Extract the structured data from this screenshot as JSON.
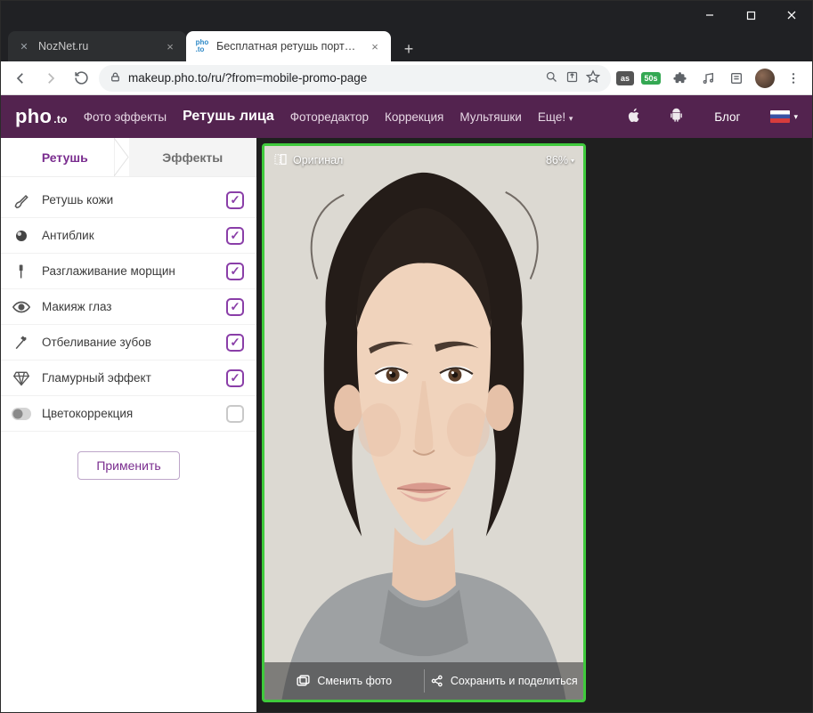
{
  "window": {
    "minimize": "—",
    "maximize": "▢",
    "close": "✕"
  },
  "browser": {
    "tabs": [
      {
        "title": "NozNet.ru",
        "active": false
      },
      {
        "title": "Бесплатная ретушь портретных",
        "active": true
      }
    ],
    "newtab": "+",
    "url": "makeup.pho.to/ru/?from=mobile-promo-page",
    "ext_badge": "50s"
  },
  "header": {
    "logo_main": "pho",
    "logo_sub": ".to",
    "menu": [
      {
        "label": "Фото эффекты",
        "active": false
      },
      {
        "label": "Ретушь лица",
        "active": true
      },
      {
        "label": "Фоторедактор",
        "active": false
      },
      {
        "label": "Коррекция",
        "active": false
      },
      {
        "label": "Мультяшки",
        "active": false
      },
      {
        "label": "Еще!",
        "active": false,
        "dropdown": true
      }
    ],
    "blog": "Блог"
  },
  "sidebar": {
    "tabs": {
      "retouch": "Ретушь",
      "effects": "Эффекты"
    },
    "options": [
      {
        "key": "skin",
        "label": "Ретушь кожи",
        "checked": true,
        "icon": "brush"
      },
      {
        "key": "shine",
        "label": "Антиблик",
        "checked": true,
        "icon": "circle"
      },
      {
        "key": "wrinkle",
        "label": "Разглаживание морщин",
        "checked": true,
        "icon": "stick"
      },
      {
        "key": "eyes",
        "label": "Макияж глаз",
        "checked": true,
        "icon": "eye"
      },
      {
        "key": "teeth",
        "label": "Отбеливание зубов",
        "checked": true,
        "icon": "brush2"
      },
      {
        "key": "glam",
        "label": "Гламурный эффект",
        "checked": true,
        "icon": "diamond"
      },
      {
        "key": "color",
        "label": "Цветокоррекция",
        "checked": false,
        "icon": "toggle"
      }
    ],
    "apply": "Применить"
  },
  "canvas": {
    "original_label": "Оригинал",
    "zoom": "86%",
    "change_photo": "Сменить фото",
    "save_share": "Сохранить и поделиться"
  }
}
